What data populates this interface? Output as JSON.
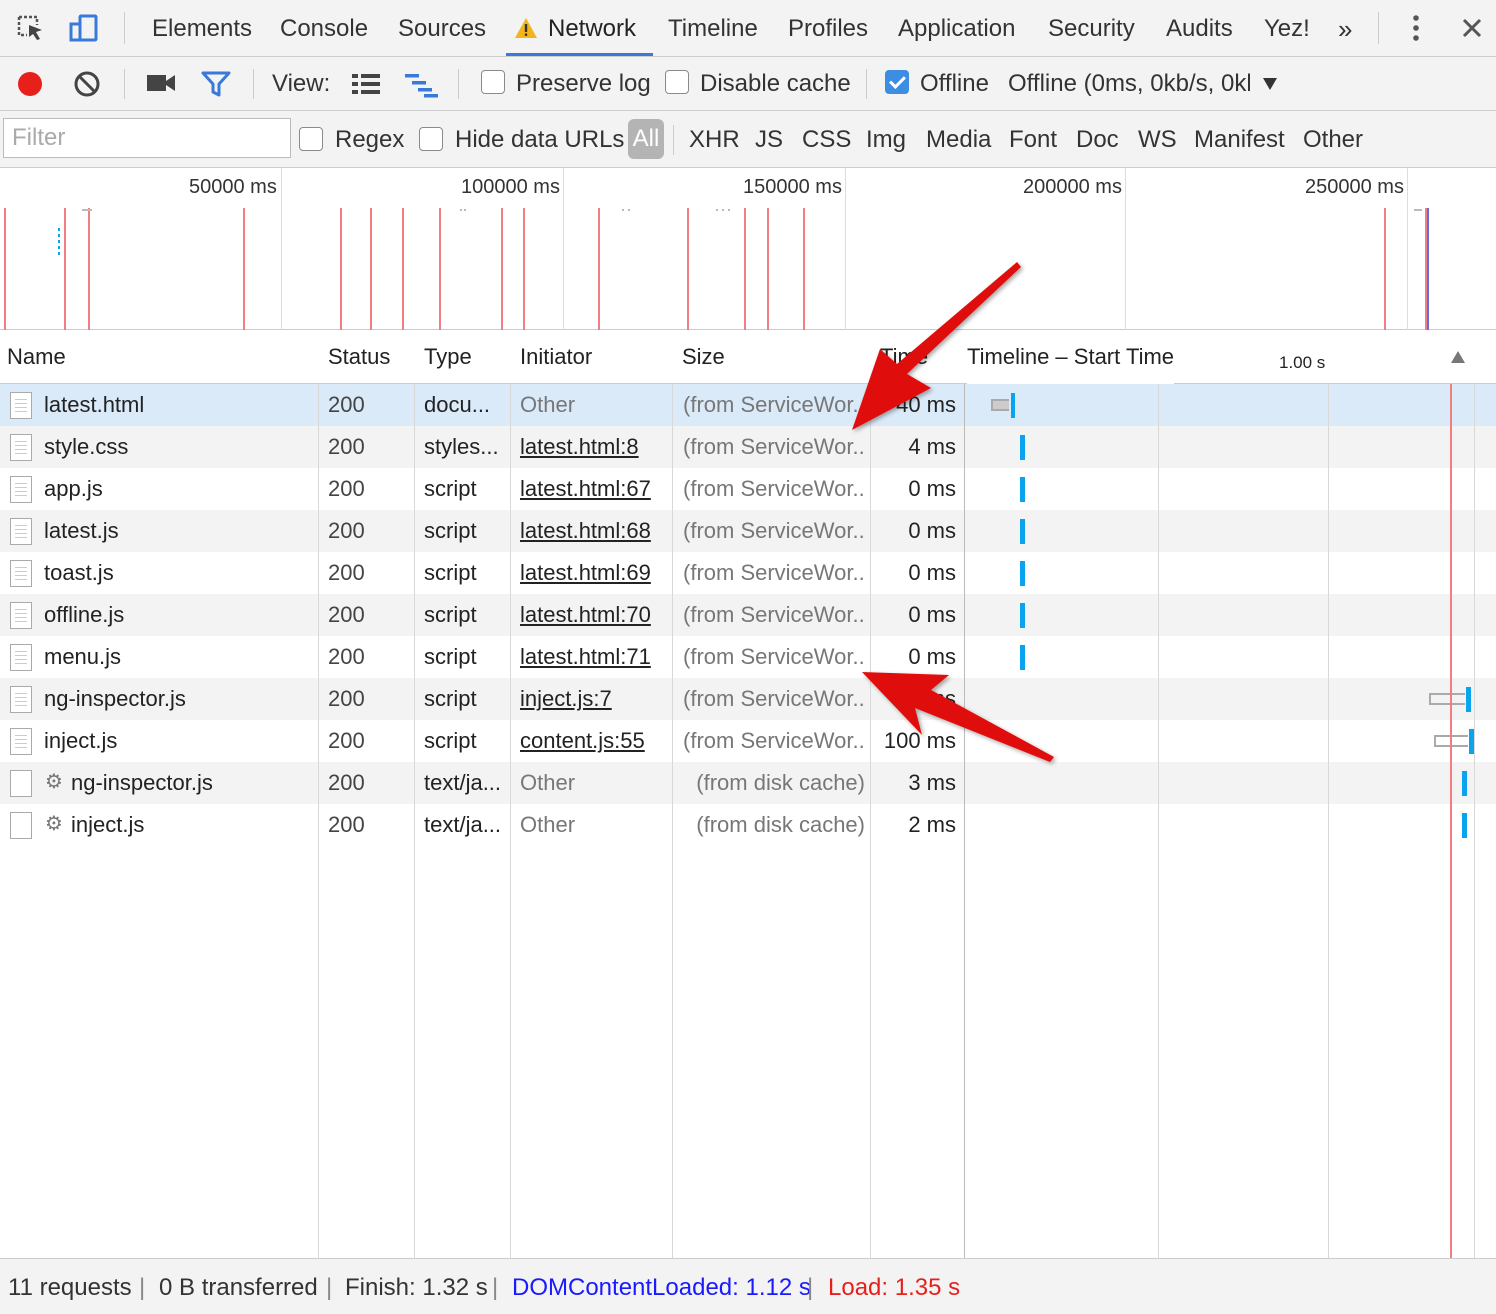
{
  "tabbar": {
    "tabs": [
      "Elements",
      "Console",
      "Sources",
      "Network",
      "Timeline",
      "Profiles",
      "Application",
      "Security",
      "Audits",
      "Yez!"
    ],
    "active": "Network",
    "overflow": "»"
  },
  "toolbar": {
    "view_label": "View:",
    "preserve_log": "Preserve log",
    "disable_cache": "Disable cache",
    "offline": "Offline",
    "throttle_value": "Offline (0ms, 0kb/s, 0kl"
  },
  "filter": {
    "placeholder": "Filter",
    "regex": "Regex",
    "hide_data_urls": "Hide data URLs",
    "types": [
      "All",
      "XHR",
      "JS",
      "CSS",
      "Img",
      "Media",
      "Font",
      "Doc",
      "WS",
      "Manifest",
      "Other"
    ]
  },
  "overview": {
    "labels": [
      "50000 ms",
      "100000 ms",
      "150000 ms",
      "200000 ms",
      "250000 ms"
    ]
  },
  "table": {
    "columns": {
      "name": "Name",
      "status": "Status",
      "type": "Type",
      "initiator": "Initiator",
      "size": "Size",
      "time": "Time",
      "timeline": "Timeline – Start Time",
      "timeline_marker": "1.00 s"
    },
    "rows": [
      {
        "name": "latest.html",
        "status": "200",
        "type": "docu...",
        "initiator": "Other",
        "size": "(from ServiceWor...",
        "time": "40 ms"
      },
      {
        "name": "style.css",
        "status": "200",
        "type": "styles...",
        "initiator": "latest.html:8",
        "size": "(from ServiceWor...",
        "time": "4 ms"
      },
      {
        "name": "app.js",
        "status": "200",
        "type": "script",
        "initiator": "latest.html:67",
        "size": "(from ServiceWor...",
        "time": "0 ms"
      },
      {
        "name": "latest.js",
        "status": "200",
        "type": "script",
        "initiator": "latest.html:68",
        "size": "(from ServiceWor...",
        "time": "0 ms"
      },
      {
        "name": "toast.js",
        "status": "200",
        "type": "script",
        "initiator": "latest.html:69",
        "size": "(from ServiceWor...",
        "time": "0 ms"
      },
      {
        "name": "offline.js",
        "status": "200",
        "type": "script",
        "initiator": "latest.html:70",
        "size": "(from ServiceWor...",
        "time": "0 ms"
      },
      {
        "name": "menu.js",
        "status": "200",
        "type": "script",
        "initiator": "latest.html:71",
        "size": "(from ServiceWor...",
        "time": "0 ms"
      },
      {
        "name": "ng-inspector.js",
        "status": "200",
        "type": "script",
        "initiator": "inject.js:7",
        "size": "(from ServiceWor...",
        "time": "20 ms"
      },
      {
        "name": "inject.js",
        "status": "200",
        "type": "script",
        "initiator": "content.js:55",
        "size": "(from ServiceWor...",
        "time": "100 ms"
      },
      {
        "name": "ng-inspector.js",
        "status": "200",
        "type": "text/ja...",
        "initiator": "Other",
        "size": "(from disk cache)",
        "time": "3 ms"
      },
      {
        "name": "inject.js",
        "status": "200",
        "type": "text/ja...",
        "initiator": "Other",
        "size": "(from disk cache)",
        "time": "2 ms"
      }
    ]
  },
  "statusbar": {
    "requests": "11 requests",
    "transferred": "0 B transferred",
    "finish": "Finish: 1.32 s",
    "dcl": "DOMContentLoaded: 1.12 s",
    "load": "Load: 1.35 s"
  },
  "colors": {
    "accent": "#3879d9",
    "record": "#e8201c",
    "dcl": "#1a1aff",
    "load": "#e8201c",
    "bar": "#0aa4ee",
    "arrow": "#e01010"
  }
}
